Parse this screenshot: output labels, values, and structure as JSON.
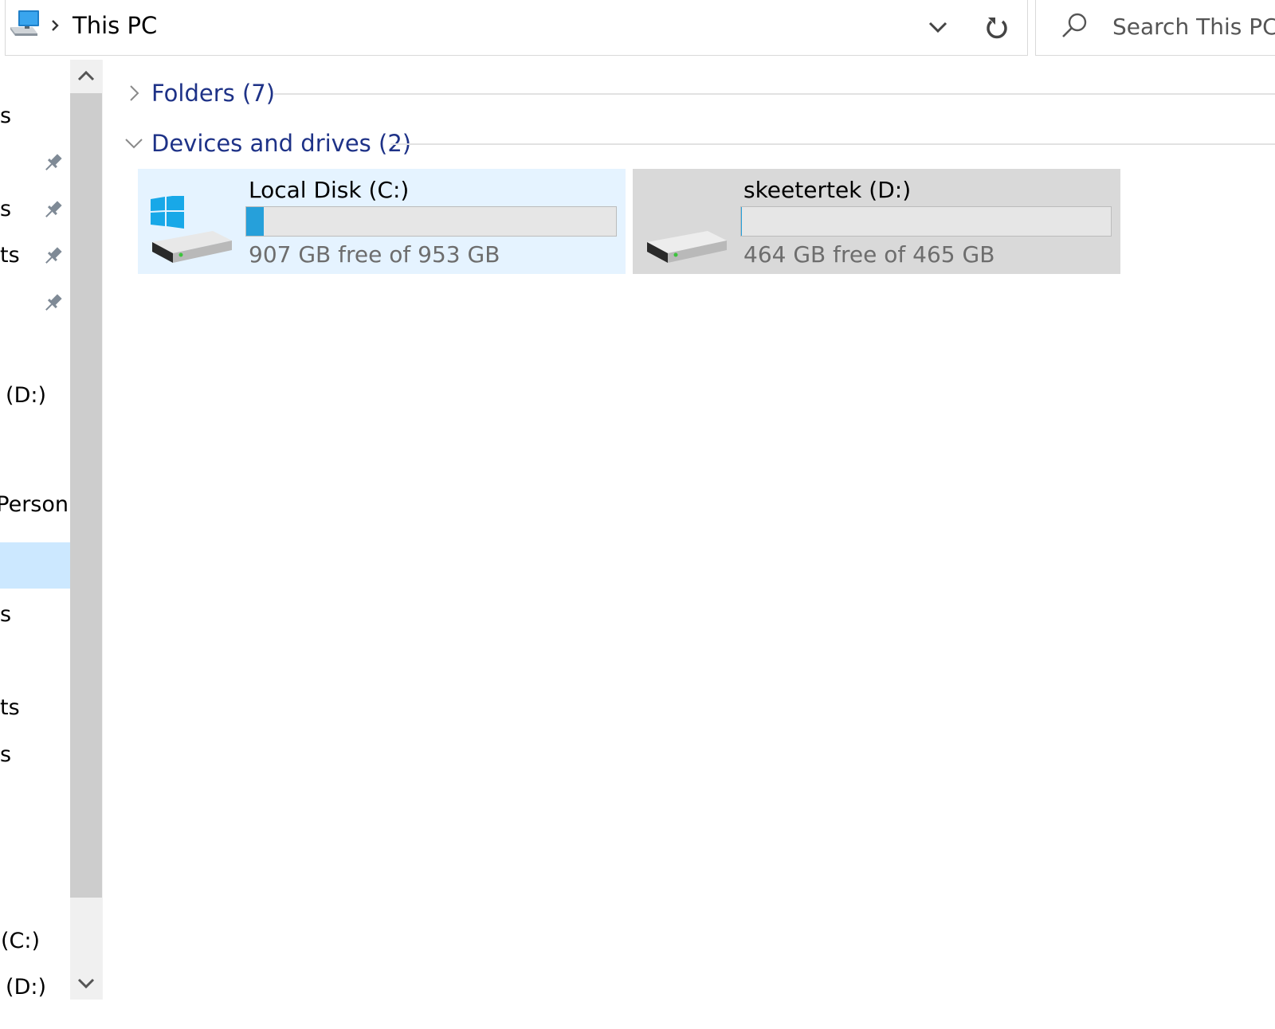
{
  "address_bar": {
    "location_icon": "this-pc-icon",
    "breadcrumb": "This PC",
    "dropdown_icon": "chevron-down-icon",
    "refresh_icon": "refresh-icon"
  },
  "search": {
    "icon": "search-icon",
    "placeholder": "Search This PC"
  },
  "nav_pane": {
    "items": [
      {
        "label": "s",
        "pinned": false
      },
      {
        "label": "",
        "pinned": true
      },
      {
        "label": "s",
        "pinned": true
      },
      {
        "label": "ts",
        "pinned": true
      },
      {
        "label": "",
        "pinned": true
      },
      {
        "label": "k (D:)",
        "pinned": false
      },
      {
        "label": "Person",
        "pinned": false
      },
      {
        "label": "",
        "selected": true
      },
      {
        "label": "s",
        "pinned": false
      },
      {
        "label": "ts",
        "pinned": false
      },
      {
        "label": "s",
        "pinned": false
      },
      {
        "label": "(C:)",
        "pinned": false
      },
      {
        "label": "k (D:)",
        "pinned": false
      }
    ],
    "pin_icon": "pin-icon"
  },
  "scrollbar": {
    "up_icon": "chevron-up-icon",
    "down_icon": "chevron-down-icon"
  },
  "groups": {
    "folders": {
      "title": "Folders (7)",
      "expanded": false
    },
    "devices": {
      "title": "Devices and drives (2)",
      "expanded": true
    }
  },
  "drives": [
    {
      "name": "Local Disk (C:)",
      "space": "907 GB free of 953 GB",
      "used_fraction": 0.048,
      "icon": "windows-system-drive-icon",
      "state": "selected"
    },
    {
      "name": "skeetertek (D:)",
      "space": "464 GB free of 465 GB",
      "used_fraction": 0.002,
      "icon": "hard-drive-icon",
      "state": "hover"
    }
  ],
  "colors": {
    "accent": "#26a0da",
    "group_title": "#1e3287",
    "selected_bg": "#e5f3ff",
    "hover_bg": "#d9d9d9",
    "nav_selected": "#cce8ff"
  }
}
